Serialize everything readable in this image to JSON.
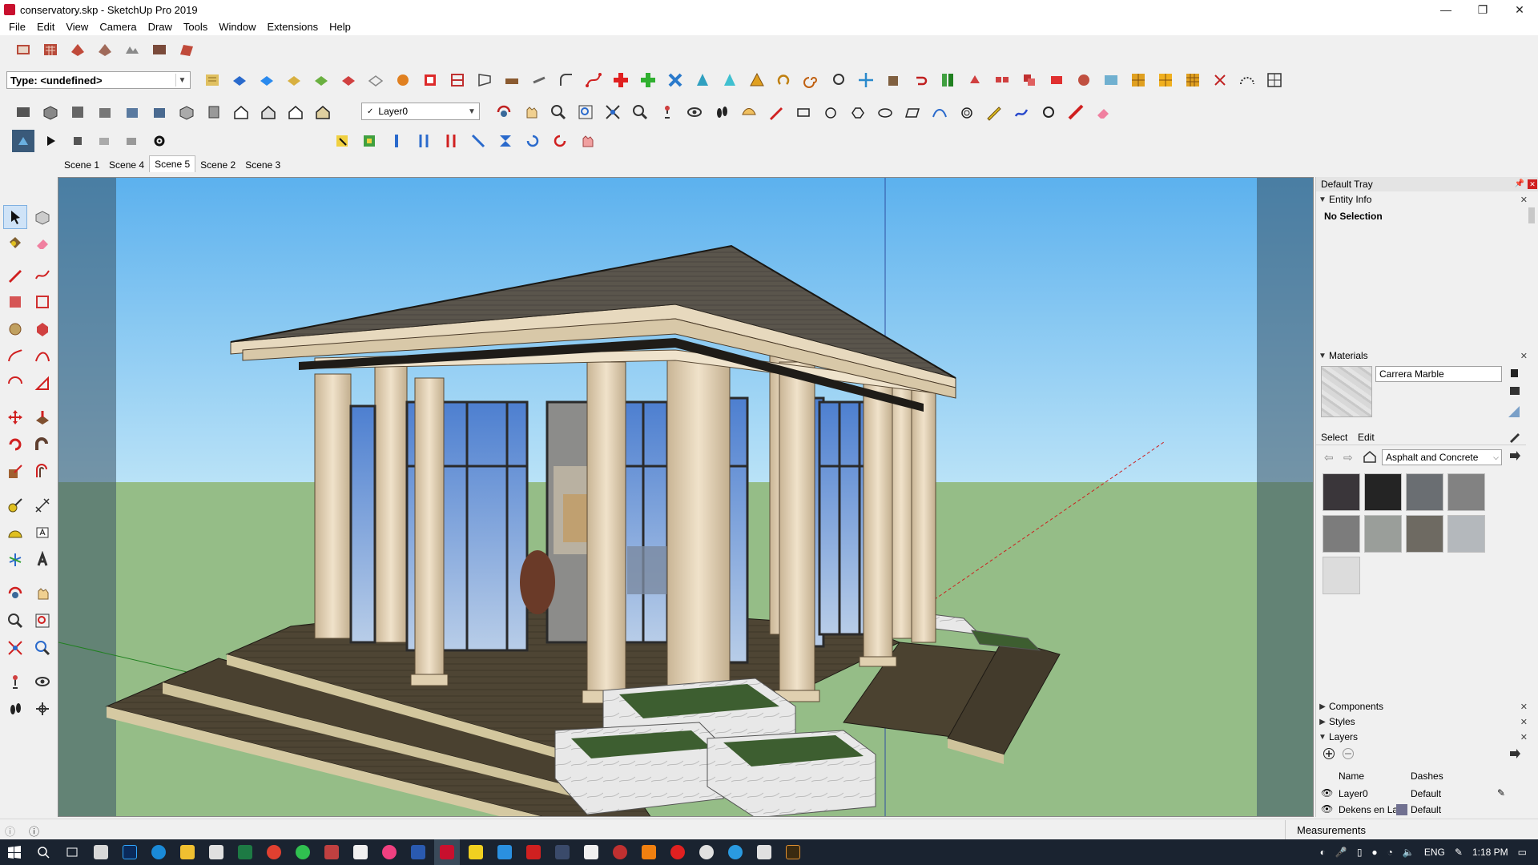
{
  "window": {
    "title": "conservatory.skp - SketchUp Pro 2019",
    "minimize": "—",
    "restore": "❐",
    "close": "✕"
  },
  "menu": [
    "File",
    "Edit",
    "View",
    "Camera",
    "Draw",
    "Tools",
    "Window",
    "Extensions",
    "Help"
  ],
  "toolbar": {
    "type_select": "Type: <undefined>",
    "layer_select": "Layer0",
    "layer_check": "✓"
  },
  "scenes": {
    "tabs": [
      "Scene 1",
      "Scene 4",
      "Scene 5",
      "Scene 2",
      "Scene 3"
    ],
    "active": "Scene 5"
  },
  "tray": {
    "title": "Default Tray",
    "entity_info": {
      "header": "Entity Info",
      "value": "No Selection"
    },
    "materials": {
      "header": "Materials",
      "material_name": "Carrera Marble",
      "tab_select": "Select",
      "tab_edit": "Edit",
      "library": "Asphalt and Concrete",
      "swatch_colors": [
        "#3a363a",
        "#242424",
        "#6a6e72",
        "#828282",
        "#7c7c7c",
        "#9a9e9a",
        "#6e6a62",
        "#b4b8bc",
        "#dcdcdc"
      ]
    },
    "components_header": "Components",
    "styles_header": "Styles",
    "layers": {
      "header": "Layers",
      "col_name": "Name",
      "col_dashes": "Dashes",
      "rows": [
        {
          "name": "Layer0",
          "dashes": "Default"
        },
        {
          "name": "Dekens en Lak",
          "dashes": "Default"
        }
      ]
    }
  },
  "status": {
    "measurements": "Measurements"
  },
  "taskbar": {
    "lang": "ENG",
    "time": "1:18 PM"
  },
  "colors": {
    "sky_top": "#6ab8ee",
    "sky_bottom": "#b7e1f7",
    "ground": "#95bd87",
    "wood": "#4b4232",
    "stone": "#e6d6bc",
    "roof": "#555046"
  }
}
